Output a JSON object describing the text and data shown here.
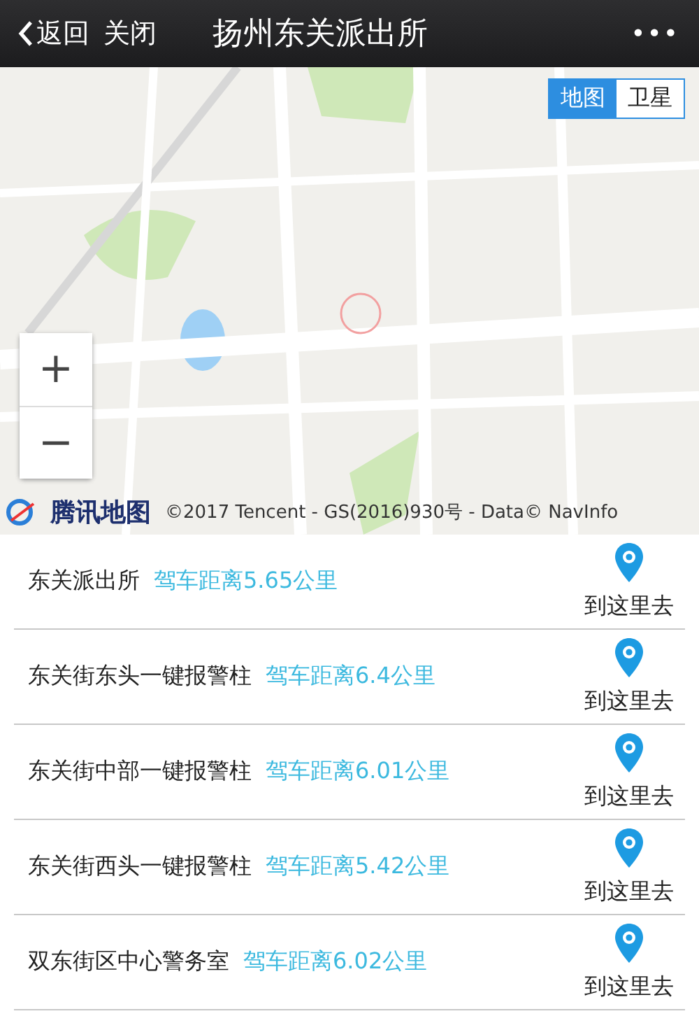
{
  "header": {
    "back": "返回",
    "close": "关闭",
    "title": "扬州东关派出所",
    "more": "•••"
  },
  "map": {
    "kind": "picture",
    "view_toggle": [
      {
        "label": "地图",
        "selected": true
      },
      {
        "label": "卫星",
        "selected": false
      }
    ],
    "zoom_in": "+",
    "zoom_out": "−",
    "logo": "腾讯地图",
    "copyright": "©2017 Tencent - GS(2016)930号 - Data© NavInfo"
  },
  "places": [
    {
      "name": "东关派出所",
      "distance": "驾车距离5.65公里",
      "action": "到这里去"
    },
    {
      "name": "东关街东头一键报警柱",
      "distance": "驾车距离6.4公里",
      "action": "到这里去"
    },
    {
      "name": "东关街中部一键报警柱",
      "distance": "驾车距离6.01公里",
      "action": "到这里去"
    },
    {
      "name": "东关街西头一键报警柱",
      "distance": "驾车距离5.42公里",
      "action": "到这里去"
    },
    {
      "name": "双东街区中心警务室",
      "distance": "驾车距离6.02公里",
      "action": "到这里去"
    }
  ]
}
